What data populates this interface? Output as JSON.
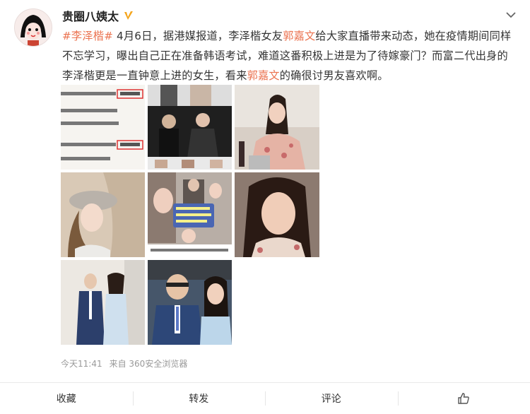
{
  "post": {
    "author": "贵圈八姨太",
    "topic": "#李泽楷#",
    "text_1": " 4月6日，据港媒报道，李泽楷女友",
    "mention_1": "郭嘉文",
    "text_2": "给大家直播带来动态，她在疫情期间同样不忘学习，曝出自己正在准备韩语考试，难道这番积极上进是为了待嫁豪门？而富二代出身的李泽楷更是一直钟意上进的女生，看来",
    "mention_2": "郭嘉文",
    "text_3": "的确很讨男友喜欢啊。",
    "time": "今天11:41",
    "source": "来自 360安全浏览器"
  },
  "actions": {
    "favorite": "收藏",
    "repost": "转发",
    "comment": "评论"
  },
  "photos": [
    {
      "name": "photo-news-screenshot",
      "bg": "#f4f2ee"
    },
    {
      "name": "photo-event-collage",
      "bg": "#2b2b2b"
    },
    {
      "name": "photo-dinner-selfie",
      "bg": "#c9b7a8"
    },
    {
      "name": "photo-hat-selfie",
      "bg": "#d9c7b2"
    },
    {
      "name": "photo-news-captions",
      "bg": "#9a8f86"
    },
    {
      "name": "photo-closeup-selfie",
      "bg": "#6a5a52"
    },
    {
      "name": "photo-couple-formal",
      "bg": "#e8e4de"
    },
    {
      "name": "photo-couple-event",
      "bg": "#3a4a5a"
    }
  ],
  "icons": {
    "verified": "verified-badge-icon",
    "chevron": "chevron-down-icon",
    "like": "thumbs-up-icon"
  },
  "colors": {
    "accent": "#eb7350",
    "verified": "#f4a51c"
  }
}
